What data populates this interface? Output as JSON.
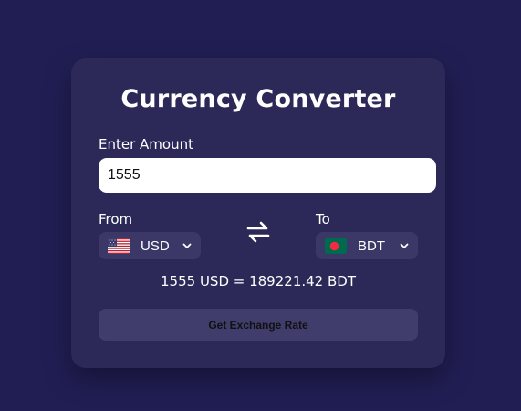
{
  "converter": {
    "title": "Currency Converter",
    "amount_label": "Enter Amount",
    "amount_value": "1555",
    "from_label": "From",
    "to_label": "To",
    "from_currency": "USD",
    "to_currency": "BDT",
    "from_flag_icon": "us-flag-icon",
    "to_flag_icon": "bangladesh-flag-icon",
    "swap_icon": "swap-arrows-icon",
    "result_text": "1555 USD = 189221.42 BDT",
    "button_label": "Get Exchange Rate"
  },
  "colors": {
    "page_background": "#211e54",
    "card_background": "#2c2958",
    "select_background": "#3b3766",
    "button_background": "#403c6b",
    "text": "#ffffff"
  }
}
